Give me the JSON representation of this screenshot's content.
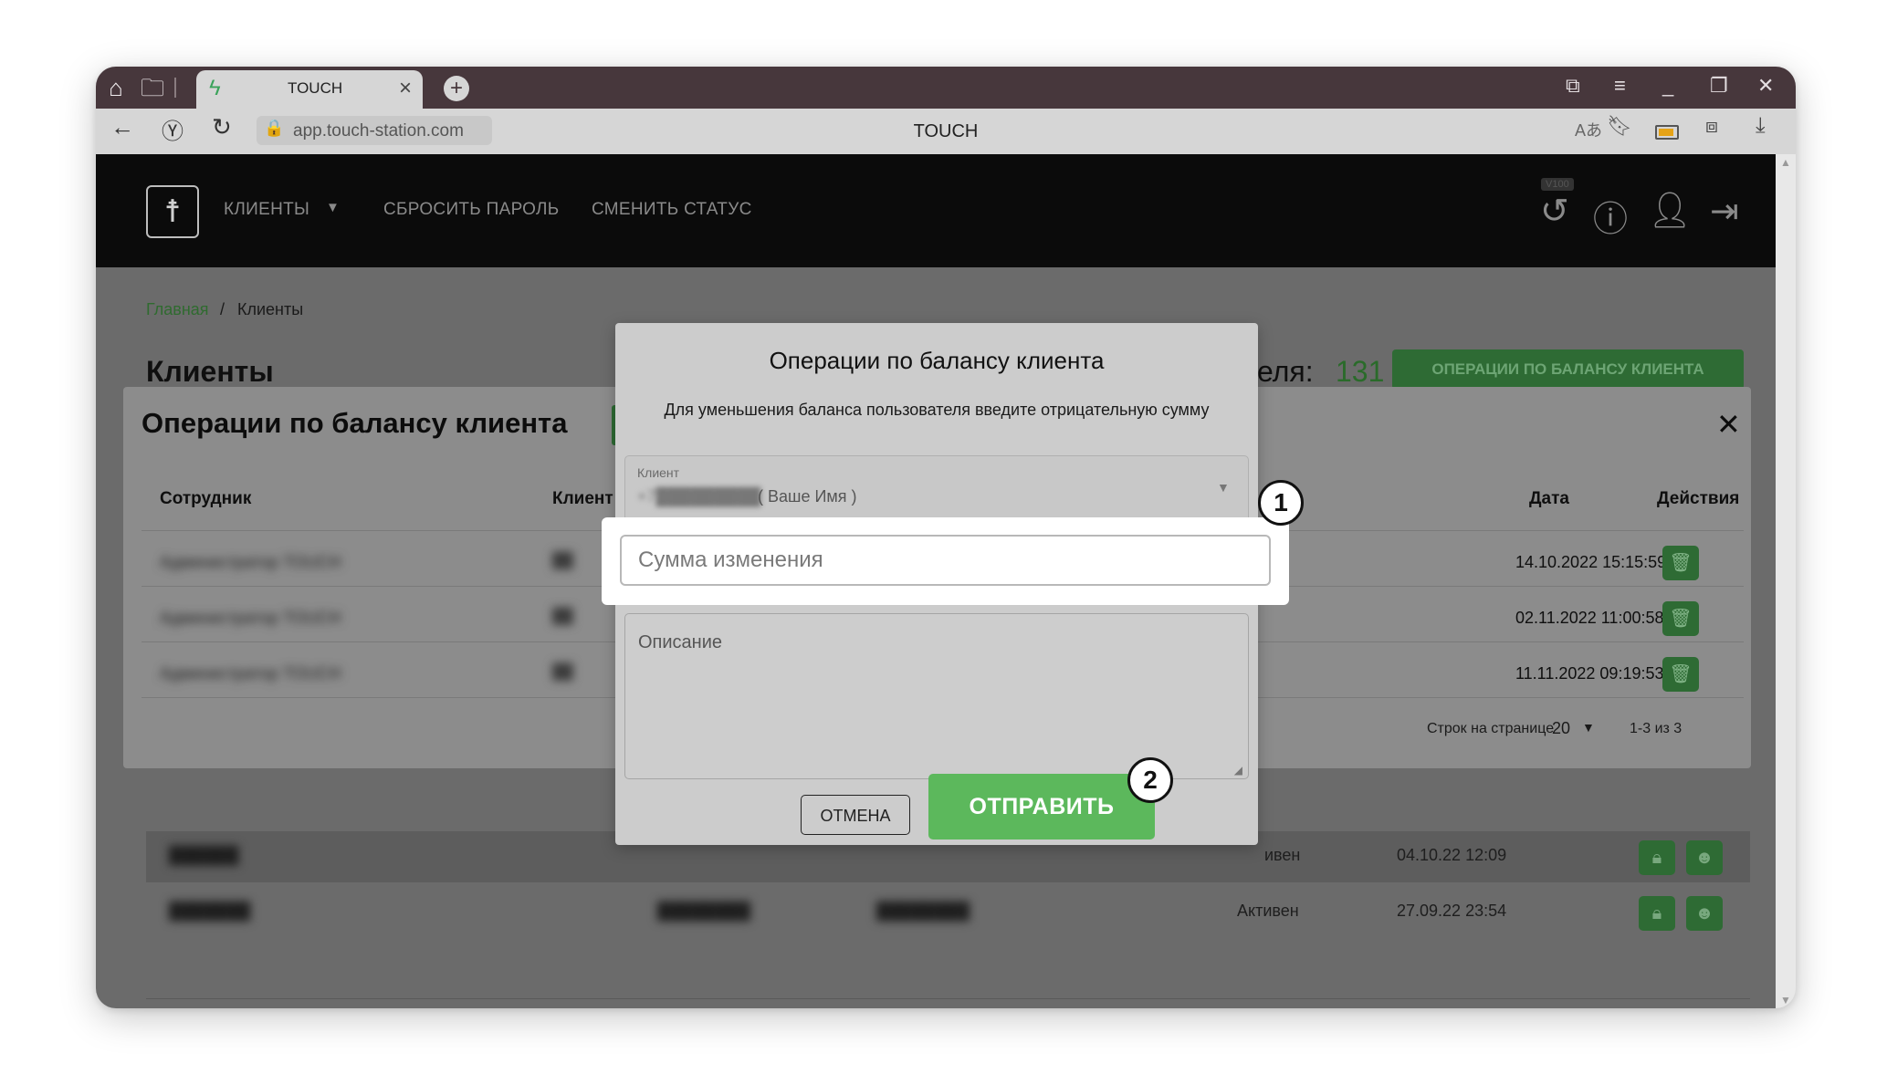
{
  "browser": {
    "tab_title": "TOUCH",
    "url": "app.touch-station.com",
    "page_heading": "TOUCH",
    "icons": [
      "home-icon",
      "folder-icon",
      "bolt-icon",
      "close-icon",
      "plus-icon",
      "bookmarks-icon",
      "menu-icon",
      "minimize-icon",
      "restore-icon",
      "close-icon",
      "back-icon",
      "yandex-icon",
      "reload-icon",
      "lock-icon",
      "translate-icon",
      "bookmark-icon",
      "battery-icon",
      "extensions-icon",
      "download-icon"
    ]
  },
  "app_nav": {
    "items": [
      "КЛИЕНТЫ",
      "СБРОСИТЬ ПАРОЛЬ",
      "СМЕНИТЬ СТАТУС"
    ],
    "version_badge": "V100",
    "right_icons": [
      "history-icon",
      "help-icon",
      "user-icon",
      "logout-icon"
    ]
  },
  "breadcrumb": {
    "home": "Главная",
    "separator": "/",
    "current": "Клиенты"
  },
  "page": {
    "title": "Клиенты",
    "count_label": "еля:",
    "count_value": "131",
    "ops_button": "ОПЕРАЦИИ ПО БАЛАНСУ КЛИЕНТА"
  },
  "background_rows": [
    {
      "status": "ивен",
      "date": "04.10.22 12:09"
    },
    {
      "status": "Активен",
      "date": "27.09.22 23:54"
    }
  ],
  "ops_modal": {
    "title": "Операции по балансу клиента",
    "columns": [
      "Сотрудник",
      "Клиент",
      "Дата",
      "Действия"
    ],
    "rows": [
      {
        "employee": "Администратор TOUCH",
        "date": "14.10.2022 15:15:59"
      },
      {
        "employee": "Администратор TOUCH",
        "date": "02.11.2022 11:00:58"
      },
      {
        "employee": "Администратор TOUCH",
        "date": "11.11.2022 09:19:53"
      }
    ],
    "rows_per_page_label": "Строк на странице",
    "rows_per_page_value": "20",
    "pagination_range": "1-3 из 3"
  },
  "dialog": {
    "title": "Операции по балансу клиента",
    "hint": "Для уменьшения баланса пользователя введите отрицательную сумму",
    "client_label": "Клиент",
    "client_value": "( Ваше Имя )",
    "amount_placeholder": "Сумма изменения",
    "description_placeholder": "Описание",
    "cancel_label": "ОТМЕНА",
    "submit_label": "ОТПРАВИТЬ"
  },
  "steps": [
    "1",
    "2"
  ],
  "colors": {
    "accent_green": "#5cb85c",
    "dark_green": "#2e6b34",
    "titlebar": "#47373c"
  }
}
